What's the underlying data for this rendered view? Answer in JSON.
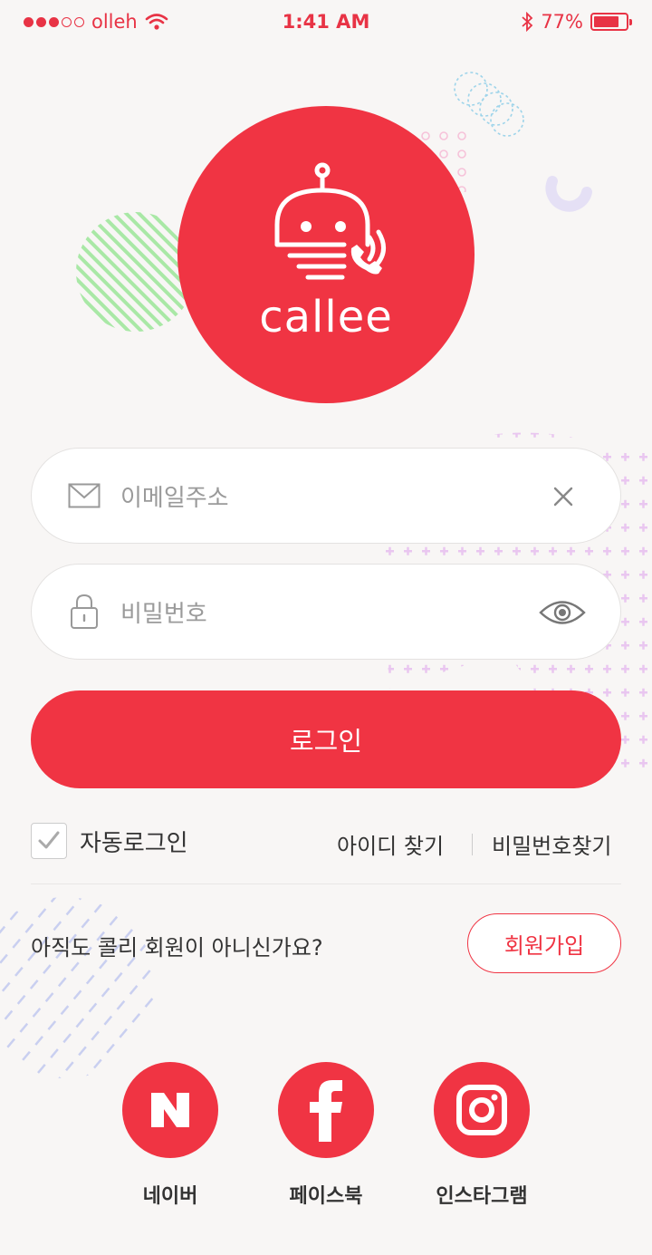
{
  "status_bar": {
    "carrier": "olleh",
    "time": "1:41 AM",
    "battery": "77%",
    "battery_level": 0.77,
    "color": "#e83345"
  },
  "logo": {
    "text": "callee",
    "icon": "robot-phone-icon",
    "color": "#f03443"
  },
  "email_field": {
    "placeholder": "이메일주소",
    "icon": "envelope-icon",
    "clear_icon": "close-icon"
  },
  "password_field": {
    "placeholder": "비밀번호",
    "icon": "lock-icon",
    "toggle_icon": "eye-icon"
  },
  "login_button": {
    "label": "로그인"
  },
  "auto_login": {
    "label": "자동로그인",
    "checked": true
  },
  "find_id": "아이디 찾기",
  "find_password": "비밀번호찾기",
  "signup_prompt": "아직도 콜리 회원이 아니신가요?",
  "signup_button": "회원가입",
  "social": [
    {
      "label": "네이버",
      "icon": "naver-icon"
    },
    {
      "label": "페이스북",
      "icon": "facebook-icon"
    },
    {
      "label": "인스타그램",
      "icon": "instagram-icon"
    }
  ],
  "accent_color": "#f03443"
}
